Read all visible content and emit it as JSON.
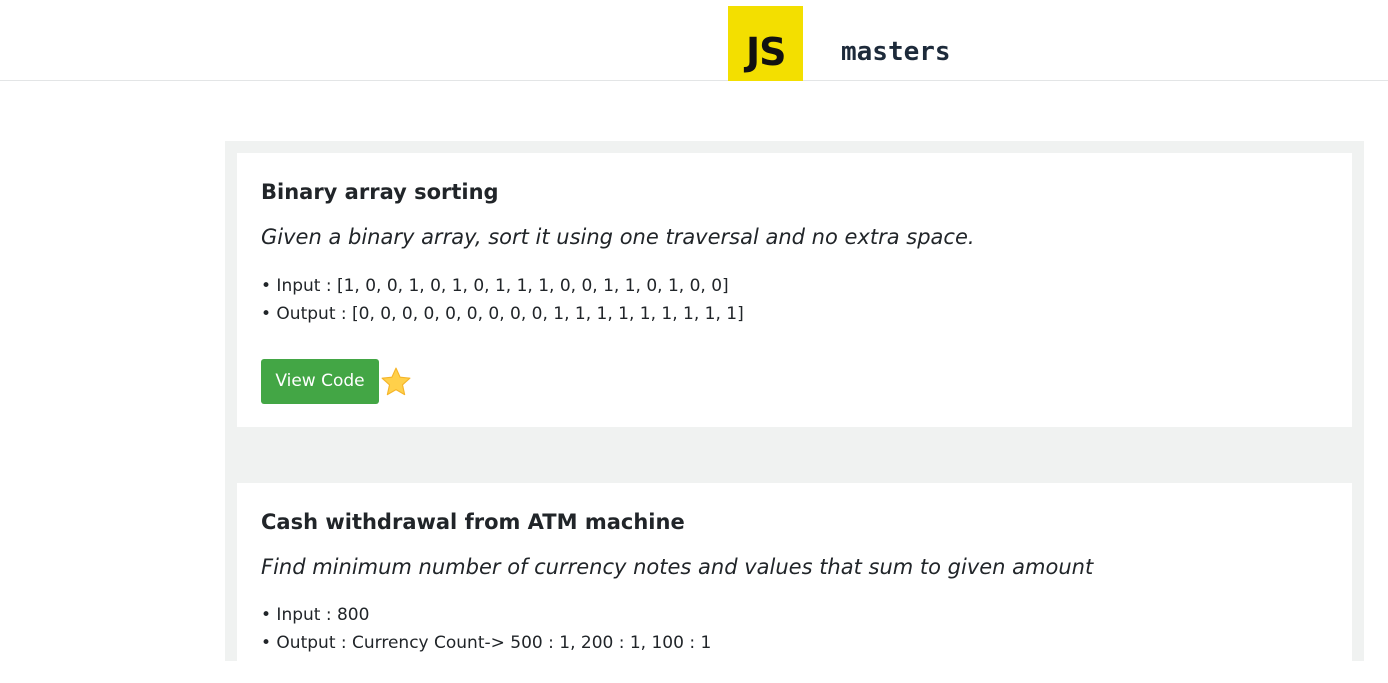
{
  "header": {
    "logo_text": "JS",
    "brand_name": "masters",
    "logo_color": "#f3df00"
  },
  "problems": [
    {
      "title": "Binary array sorting",
      "description": "Given a binary array, sort it using one traversal and no extra space.",
      "input": "• Input : [1, 0, 0, 1, 0, 1, 0, 1, 1, 1, 0, 0, 1, 1, 0, 1, 0, 0]",
      "output": "• Output : [0, 0, 0, 0, 0, 0, 0, 0, 0, 1, 1, 1, 1, 1, 1, 1, 1, 1]",
      "button_label": "View Code",
      "favorite_icon": "star-icon"
    },
    {
      "title": "Cash withdrawal from ATM machine",
      "description": "Find minimum number of currency notes and values that sum to given amount",
      "input": "• Input : 800",
      "output": "• Output : Currency Count-> 500 : 1, 200 : 1, 100 : 1"
    }
  ],
  "colors": {
    "button_green": "#43a645",
    "feed_background": "#f0f2f1",
    "star_yellow": "#ffd04a"
  }
}
